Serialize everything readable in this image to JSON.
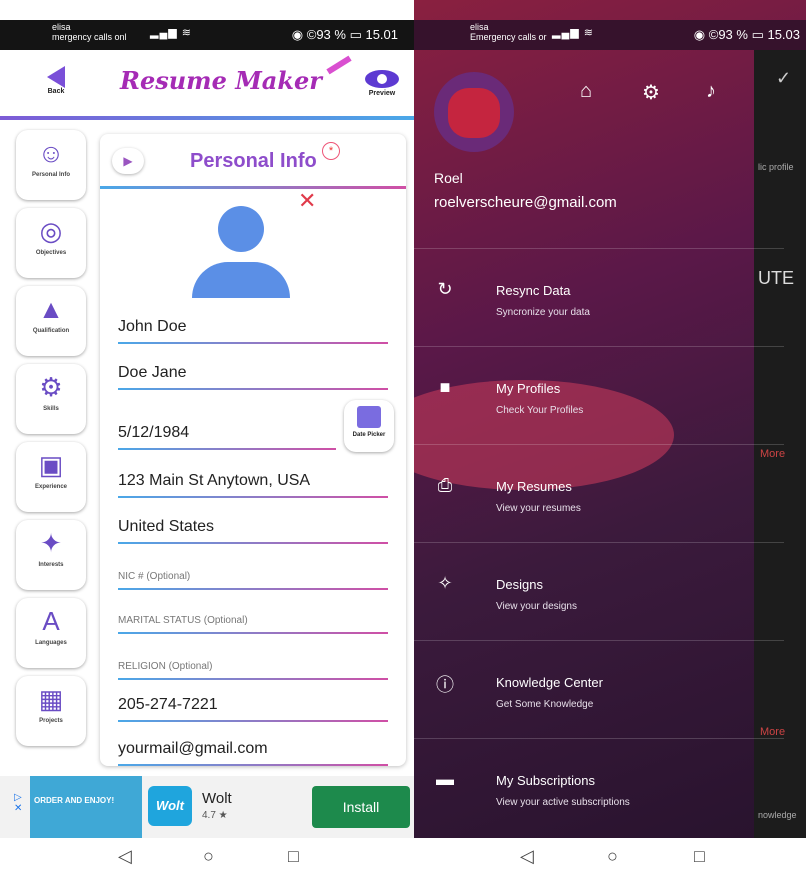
{
  "left_status": {
    "carrier": "elisa",
    "carrier2": "mergency calls onl",
    "right": "◉ ©93 % ▭ 15.01"
  },
  "header": {
    "back_label": "Back",
    "app_title": "Resume Maker",
    "preview_label": "Preview"
  },
  "sidebar": {
    "items": [
      {
        "label": "Personal Info",
        "icon": "person-icon",
        "glyph": "☺"
      },
      {
        "label": "Objectives",
        "icon": "target-icon",
        "glyph": "◎"
      },
      {
        "label": "Qualification",
        "icon": "graduation-cap-icon",
        "glyph": "▲"
      },
      {
        "label": "Skills",
        "icon": "skills-icon",
        "glyph": "⚙"
      },
      {
        "label": "Experience",
        "icon": "briefcase-icon",
        "glyph": "▣"
      },
      {
        "label": "Interests",
        "icon": "interests-icon",
        "glyph": "✦"
      },
      {
        "label": "Languages",
        "icon": "languages-icon",
        "glyph": "A"
      },
      {
        "label": "Projects",
        "icon": "projects-icon",
        "glyph": "▦"
      }
    ]
  },
  "card": {
    "title": "Personal Info",
    "badge": "*",
    "fields": [
      {
        "value": "John Doe"
      },
      {
        "value": "Doe Jane"
      },
      {
        "value": "5/12/1984"
      },
      {
        "value": "123 Main St Anytown, USA"
      },
      {
        "value": "United States"
      },
      {
        "placeholder": "NIC # (Optional)"
      },
      {
        "placeholder": "MARITAL STATUS (Optional)"
      },
      {
        "placeholder": "RELIGION (Optional)"
      },
      {
        "value": "205-274-7221"
      },
      {
        "value": "yourmail@gmail.com"
      }
    ],
    "date_picker_label": "Date Picker"
  },
  "ad": {
    "image_text": "ORDER AND ENJOY!",
    "logo": "Wolt",
    "name": "Wolt",
    "rating": "4.7 ★",
    "install": "Install"
  },
  "right_status": {
    "carrier": "elisa",
    "carrier2": "Emergency calls or",
    "right": "◉ ©93 % ▭ 15.03"
  },
  "drawer": {
    "name": "Roel",
    "email": "roelverscheure@gmail.com",
    "items": [
      {
        "title": "Resync Data",
        "subtitle": "Syncronize your data",
        "icon": "sync-icon",
        "glyph": "↻"
      },
      {
        "title": "My Profiles",
        "subtitle": "Check Your Profiles",
        "icon": "profile-card-icon",
        "glyph": "■"
      },
      {
        "title": "My Resumes",
        "subtitle": "View your resumes",
        "icon": "document-icon",
        "glyph": "⎙"
      },
      {
        "title": "Designs",
        "subtitle": "View your designs",
        "icon": "magic-wand-icon",
        "glyph": "✧"
      },
      {
        "title": "Knowledge Center",
        "subtitle": "Get Some Knowledge",
        "icon": "info-icon",
        "glyph": "ⓘ"
      },
      {
        "title": "My Subscriptions",
        "subtitle": "View your active subscriptions",
        "icon": "wallet-icon",
        "glyph": "▬"
      }
    ]
  },
  "background_ghost": {
    "profile_text": "lic profile",
    "ute_text": "UTE",
    "more1": "More",
    "more2": "More",
    "knowledge_text": "nowledge"
  }
}
